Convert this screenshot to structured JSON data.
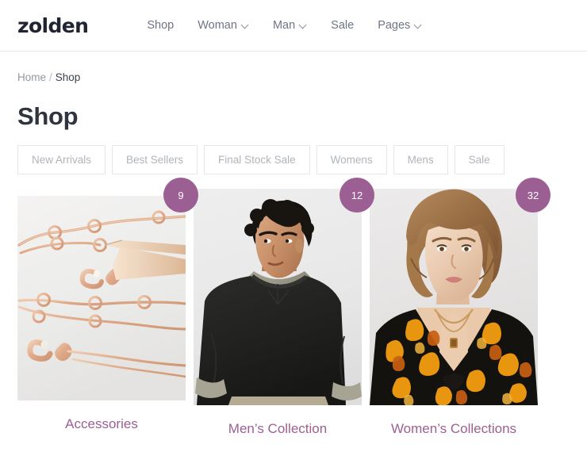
{
  "header": {
    "brand": "zolden",
    "nav": [
      {
        "label": "Shop",
        "has_dropdown": false,
        "icon": ""
      },
      {
        "label": "Woman",
        "has_dropdown": true,
        "icon": "chevron-down-icon"
      },
      {
        "label": "Man",
        "has_dropdown": true,
        "icon": "chevron-down-icon"
      },
      {
        "label": "Sale",
        "has_dropdown": false,
        "icon": ""
      },
      {
        "label": "Pages",
        "has_dropdown": true,
        "icon": "chevron-down-icon"
      }
    ]
  },
  "breadcrumb": {
    "home": "Home",
    "separator": "/",
    "current": "Shop"
  },
  "page": {
    "title": "Shop"
  },
  "filters": [
    {
      "label": "New Arrivals"
    },
    {
      "label": "Best Sellers"
    },
    {
      "label": "Final Stock Sale"
    },
    {
      "label": "Womens"
    },
    {
      "label": "Mens"
    },
    {
      "label": "Sale"
    }
  ],
  "products": [
    {
      "title": "Accessories",
      "count": "9",
      "image_alt": "rose-gold-jewelry-chains-photo"
    },
    {
      "title": "Men’s Collection",
      "count": "12",
      "image_alt": "man-in-black-crewneck-sweatshirt-photo"
    },
    {
      "title": "Women’s Collections",
      "count": "32",
      "image_alt": "woman-in-orange-print-v-neck-dress-photo"
    }
  ],
  "colors": {
    "accent": "#9c5f93",
    "text_dark": "#2f343f",
    "text_muted": "#6e7584",
    "pill_text": "#b1b4bb",
    "border": "#e6e6e9"
  }
}
